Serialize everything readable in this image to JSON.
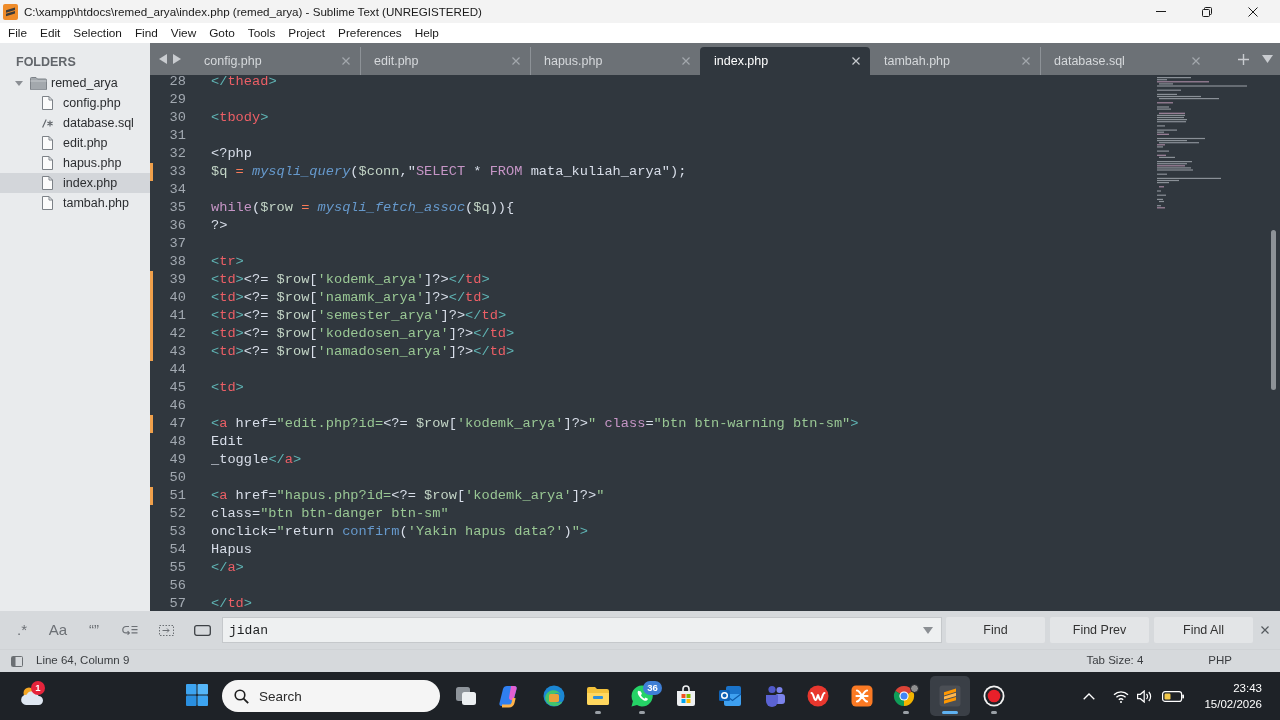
{
  "window": {
    "title": "C:\\xampp\\htdocs\\remed_arya\\index.php (remed_arya) - Sublime Text (UNREGISTERED)"
  },
  "menu": [
    "File",
    "Edit",
    "Selection",
    "Find",
    "View",
    "Goto",
    "Tools",
    "Project",
    "Preferences",
    "Help"
  ],
  "sidebar": {
    "heading": "FOLDERS",
    "folders": [
      {
        "label": "remed_arya",
        "expanded": true,
        "children": [
          {
            "label": "config.php",
            "kind": "file",
            "selected": false
          },
          {
            "label": "database.sql",
            "kind": "sql",
            "selected": false
          },
          {
            "label": "edit.php",
            "kind": "file",
            "selected": false
          },
          {
            "label": "hapus.php",
            "kind": "file",
            "selected": false
          },
          {
            "label": "index.php",
            "kind": "file",
            "selected": true
          },
          {
            "label": "tambah.php",
            "kind": "file",
            "selected": false
          }
        ]
      }
    ]
  },
  "tabs": [
    {
      "label": "config.php",
      "selected": false
    },
    {
      "label": "edit.php",
      "selected": false
    },
    {
      "label": "hapus.php",
      "selected": false
    },
    {
      "label": "index.php",
      "selected": true
    },
    {
      "label": "tambah.php",
      "selected": false
    },
    {
      "label": "database.sql",
      "selected": false
    }
  ],
  "editor": {
    "lines": [
      {
        "number": "28",
        "modified": false,
        "tokens": [
          {
            "kind": "bracket",
            "text": "</"
          },
          {
            "kind": "tag",
            "text": "thead"
          },
          {
            "kind": "bracket",
            "text": ">"
          }
        ]
      },
      {
        "number": "29",
        "modified": false
      },
      {
        "number": "30",
        "modified": false,
        "tokens": [
          {
            "kind": "bracket",
            "text": "<"
          },
          {
            "kind": "tag",
            "text": "tbody"
          },
          {
            "kind": "bracket",
            "text": ">"
          }
        ]
      },
      {
        "number": "31",
        "modified": false
      },
      {
        "number": "32",
        "modified": false,
        "tokens": [
          {
            "kind": "text",
            "text": "<?php"
          }
        ]
      },
      {
        "number": "33",
        "modified": true,
        "tokens": [
          {
            "kind": "variable",
            "text": "$q"
          },
          {
            "kind": "operator",
            "text": " = "
          },
          {
            "kind": "function",
            "text": "mysqli_query"
          },
          {
            "kind": "text",
            "text": "("
          },
          {
            "kind": "variable",
            "text": "$conn"
          },
          {
            "kind": "text",
            "text": ",\""
          },
          {
            "kind": "keyword",
            "text": "SELECT"
          },
          {
            "kind": "text",
            "text": " * "
          },
          {
            "kind": "keyword",
            "text": "FROM"
          },
          {
            "kind": "text",
            "text": " mata_kuliah_arya\");"
          }
        ]
      },
      {
        "number": "34",
        "modified": false
      },
      {
        "number": "35",
        "modified": false,
        "tokens": [
          {
            "kind": "keyword",
            "text": "while"
          },
          {
            "kind": "text",
            "text": "("
          },
          {
            "kind": "variable",
            "text": "$row"
          },
          {
            "kind": "operator",
            "text": " = "
          },
          {
            "kind": "function",
            "text": "mysqli_fetch_assoc"
          },
          {
            "kind": "text",
            "text": "("
          },
          {
            "kind": "variable",
            "text": "$q"
          },
          {
            "kind": "text",
            "text": ")){"
          }
        ]
      },
      {
        "number": "36",
        "modified": false,
        "tokens": [
          {
            "kind": "text",
            "text": "?>"
          }
        ]
      },
      {
        "number": "37",
        "modified": false
      },
      {
        "number": "38",
        "modified": false,
        "tokens": [
          {
            "kind": "bracket",
            "text": "<"
          },
          {
            "kind": "tag",
            "text": "tr"
          },
          {
            "kind": "bracket",
            "text": ">"
          }
        ]
      },
      {
        "number": "39",
        "modified": true,
        "tokens": [
          {
            "kind": "bracket",
            "text": "<"
          },
          {
            "kind": "tag",
            "text": "td"
          },
          {
            "kind": "bracket",
            "text": ">"
          },
          {
            "kind": "text",
            "text": "<?= "
          },
          {
            "kind": "variable",
            "text": "$row"
          },
          {
            "kind": "text",
            "text": "["
          },
          {
            "kind": "string",
            "text": "'kodemk_arya'"
          },
          {
            "kind": "text",
            "text": "]?>"
          },
          {
            "kind": "bracket",
            "text": "</"
          },
          {
            "kind": "tag",
            "text": "td"
          },
          {
            "kind": "bracket",
            "text": ">"
          }
        ]
      },
      {
        "number": "40",
        "modified": true,
        "tokens": [
          {
            "kind": "bracket",
            "text": "<"
          },
          {
            "kind": "tag",
            "text": "td"
          },
          {
            "kind": "bracket",
            "text": ">"
          },
          {
            "kind": "text",
            "text": "<?= "
          },
          {
            "kind": "variable",
            "text": "$row"
          },
          {
            "kind": "text",
            "text": "["
          },
          {
            "kind": "string",
            "text": "'namamk_arya'"
          },
          {
            "kind": "text",
            "text": "]?>"
          },
          {
            "kind": "bracket",
            "text": "</"
          },
          {
            "kind": "tag",
            "text": "td"
          },
          {
            "kind": "bracket",
            "text": ">"
          }
        ]
      },
      {
        "number": "41",
        "modified": true,
        "tokens": [
          {
            "kind": "bracket",
            "text": "<"
          },
          {
            "kind": "tag",
            "text": "td"
          },
          {
            "kind": "bracket",
            "text": ">"
          },
          {
            "kind": "text",
            "text": "<?= "
          },
          {
            "kind": "variable",
            "text": "$row"
          },
          {
            "kind": "text",
            "text": "["
          },
          {
            "kind": "string",
            "text": "'semester_arya'"
          },
          {
            "kind": "text",
            "text": "]?>"
          },
          {
            "kind": "bracket",
            "text": "</"
          },
          {
            "kind": "tag",
            "text": "td"
          },
          {
            "kind": "bracket",
            "text": ">"
          }
        ]
      },
      {
        "number": "42",
        "modified": true,
        "tokens": [
          {
            "kind": "bracket",
            "text": "<"
          },
          {
            "kind": "tag",
            "text": "td"
          },
          {
            "kind": "bracket",
            "text": ">"
          },
          {
            "kind": "text",
            "text": "<?= "
          },
          {
            "kind": "variable",
            "text": "$row"
          },
          {
            "kind": "text",
            "text": "["
          },
          {
            "kind": "string",
            "text": "'kodedosen_arya'"
          },
          {
            "kind": "text",
            "text": "]?>"
          },
          {
            "kind": "bracket",
            "text": "</"
          },
          {
            "kind": "tag",
            "text": "td"
          },
          {
            "kind": "bracket",
            "text": ">"
          }
        ]
      },
      {
        "number": "43",
        "modified": true,
        "tokens": [
          {
            "kind": "bracket",
            "text": "<"
          },
          {
            "kind": "tag",
            "text": "td"
          },
          {
            "kind": "bracket",
            "text": ">"
          },
          {
            "kind": "text",
            "text": "<?= "
          },
          {
            "kind": "variable",
            "text": "$row"
          },
          {
            "kind": "text",
            "text": "["
          },
          {
            "kind": "string",
            "text": "'namadosen_arya'"
          },
          {
            "kind": "text",
            "text": "]?>"
          },
          {
            "kind": "bracket",
            "text": "</"
          },
          {
            "kind": "tag",
            "text": "td"
          },
          {
            "kind": "bracket",
            "text": ">"
          }
        ]
      },
      {
        "number": "44",
        "modified": false
      },
      {
        "number": "45",
        "modified": false,
        "tokens": [
          {
            "kind": "bracket",
            "text": "<"
          },
          {
            "kind": "tag",
            "text": "td"
          },
          {
            "kind": "bracket",
            "text": ">"
          }
        ]
      },
      {
        "number": "46",
        "modified": false
      },
      {
        "number": "47",
        "modified": true,
        "tokens": [
          {
            "kind": "bracket",
            "text": "<"
          },
          {
            "kind": "tag",
            "text": "a"
          },
          {
            "kind": "text",
            "text": " href="
          },
          {
            "kind": "string",
            "text": "\"edit.php?id="
          },
          {
            "kind": "text",
            "text": "<?= "
          },
          {
            "kind": "variable",
            "text": "$row"
          },
          {
            "kind": "text",
            "text": "["
          },
          {
            "kind": "string",
            "text": "'kodemk_arya'"
          },
          {
            "kind": "text",
            "text": "]?>"
          },
          {
            "kind": "string",
            "text": "\""
          },
          {
            "kind": "keyword",
            "text": " class"
          },
          {
            "kind": "text",
            "text": "="
          },
          {
            "kind": "string",
            "text": "\"btn btn-warning btn-sm\""
          },
          {
            "kind": "bracket",
            "text": ">"
          }
        ]
      },
      {
        "number": "48",
        "modified": false,
        "tokens": [
          {
            "kind": "text",
            "text": "Edit"
          }
        ]
      },
      {
        "number": "49",
        "modified": false,
        "tokens": [
          {
            "kind": "text",
            "text": "_toggle"
          },
          {
            "kind": "bracket",
            "text": "</"
          },
          {
            "kind": "tag",
            "text": "a"
          },
          {
            "kind": "bracket",
            "text": ">"
          }
        ]
      },
      {
        "number": "50",
        "modified": false
      },
      {
        "number": "51",
        "modified": true,
        "tokens": [
          {
            "kind": "bracket",
            "text": "<"
          },
          {
            "kind": "tag",
            "text": "a"
          },
          {
            "kind": "text",
            "text": " href="
          },
          {
            "kind": "string",
            "text": "\"hapus.php?id="
          },
          {
            "kind": "text",
            "text": "<?= "
          },
          {
            "kind": "variable",
            "text": "$row"
          },
          {
            "kind": "text",
            "text": "["
          },
          {
            "kind": "string",
            "text": "'kodemk_arya'"
          },
          {
            "kind": "text",
            "text": "]?>"
          },
          {
            "kind": "string",
            "text": "\""
          }
        ]
      },
      {
        "number": "52",
        "modified": false,
        "tokens": [
          {
            "kind": "text",
            "text": "class="
          },
          {
            "kind": "string",
            "text": "\"btn btn-danger btn-sm\""
          }
        ]
      },
      {
        "number": "53",
        "modified": false,
        "tokens": [
          {
            "kind": "text",
            "text": "onclick="
          },
          {
            "kind": "string",
            "text": "\""
          },
          {
            "kind": "text",
            "text": "return "
          },
          {
            "kind": "call",
            "text": "confirm"
          },
          {
            "kind": "text",
            "text": "("
          },
          {
            "kind": "string",
            "text": "'Yakin hapus data?'"
          },
          {
            "kind": "text",
            "text": ")"
          },
          {
            "kind": "string",
            "text": "\""
          },
          {
            "kind": "bracket",
            "text": ">"
          }
        ]
      },
      {
        "number": "54",
        "modified": false,
        "tokens": [
          {
            "kind": "text",
            "text": "Hapus"
          }
        ]
      },
      {
        "number": "55",
        "modified": false,
        "tokens": [
          {
            "kind": "bracket",
            "text": "</"
          },
          {
            "kind": "tag",
            "text": "a"
          },
          {
            "kind": "bracket",
            "text": ">"
          }
        ]
      },
      {
        "number": "56",
        "modified": false
      },
      {
        "number": "57",
        "modified": false,
        "tokens": [
          {
            "kind": "bracket",
            "text": "</"
          },
          {
            "kind": "tag",
            "text": "td"
          },
          {
            "kind": "bracket",
            "text": ">"
          }
        ]
      }
    ]
  },
  "find_panel": {
    "options": [
      {
        "kind": "label",
        "label": ".*"
      },
      {
        "kind": "label",
        "label": "Aa"
      },
      {
        "kind": "label",
        "label": "“”"
      },
      {
        "kind": "wrap"
      },
      {
        "kind": "selection"
      },
      {
        "kind": "highlight"
      }
    ],
    "field": {
      "value": "jidan"
    },
    "buttons": [
      "Find",
      "Find Prev",
      "Find All"
    ]
  },
  "status_bar": {
    "position": "Line 64, Column 9",
    "tab_size": "Tab Size: 4",
    "syntax": "PHP"
  },
  "taskbar": {
    "widgets": {
      "badge": "1"
    },
    "search": {
      "placeholder": "Search"
    },
    "apps": [
      {
        "kind": "overlap",
        "running": false,
        "active": false
      },
      {
        "kind": "swirl",
        "running": false,
        "active": false
      },
      {
        "kind": "wave",
        "running": false,
        "active": false
      },
      {
        "kind": "folder",
        "running": true,
        "active": false
      },
      {
        "kind": "chat",
        "running": true,
        "active": false,
        "badge": "36"
      },
      {
        "kind": "bag",
        "running": false,
        "active": false
      },
      {
        "kind": "mail",
        "running": false,
        "active": false
      },
      {
        "kind": "people",
        "running": false,
        "active": false
      },
      {
        "kind": "zigzag",
        "running": false,
        "active": false
      },
      {
        "kind": "knot",
        "running": false,
        "active": false
      },
      {
        "kind": "segments",
        "running": true,
        "active": false
      },
      {
        "kind": "stripes",
        "running": true,
        "active": true
      },
      {
        "kind": "record",
        "running": true,
        "active": false
      }
    ],
    "clock": {
      "time": "23:43",
      "date": "15/02/2026"
    }
  }
}
